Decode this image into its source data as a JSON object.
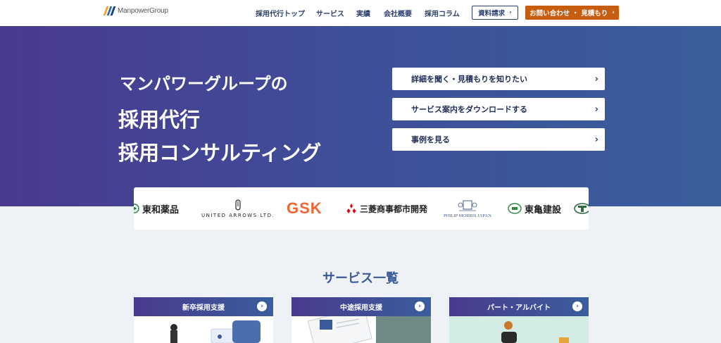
{
  "header": {
    "logo_text": "ManpowerGroup",
    "nav": [
      "採用代行トップ",
      "サービス",
      "実績",
      "会社概要",
      "採用コラム"
    ],
    "doc_button": "資料請求",
    "contact_button": "お問い合わせ ・ 見積もり"
  },
  "hero": {
    "line1": "マンパワーグループの",
    "line2": "採用代行",
    "line3": "採用コンサルティング",
    "buttons": [
      "詳細を聞く・見積もりを知りたい",
      "サービス案内をダウンロードする",
      "事例を見る"
    ]
  },
  "logos": {
    "towa": "東和薬品",
    "united_arrows": "UNITED ARROWS LTD.",
    "gsk": "GSK",
    "mitsubishi": "三菱商事都市開発",
    "philip_morris": "PHILIP MORRIS JAPAN",
    "tokyu": "東亀建設"
  },
  "services": {
    "title": "サービス一覧",
    "cards": [
      "新卒採用支援",
      "中途採用支援",
      "パート・アルバイト"
    ]
  },
  "colors": {
    "brand_navy": "#2c3e6e",
    "accent_orange": "#c65d10",
    "hero_start": "#4a3a8f",
    "hero_end": "#3a5e9c",
    "gsk_orange": "#f36633",
    "mitsubishi_red": "#e60012",
    "tokyu_green": "#2e8b3e"
  }
}
